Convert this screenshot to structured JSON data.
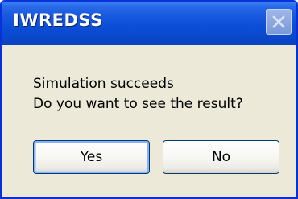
{
  "window": {
    "title": "IWREDSS",
    "close_icon": "close-icon"
  },
  "message": {
    "line1": "Simulation succeeds",
    "line2": "Do you want to see the result?"
  },
  "buttons": {
    "yes_label": "Yes",
    "no_label": "No"
  },
  "colors": {
    "titlebar": "#0d4fd8",
    "dialog_background": "#ece9d8",
    "border": "#0831d9",
    "focus_ring": "#8cb0f8"
  }
}
